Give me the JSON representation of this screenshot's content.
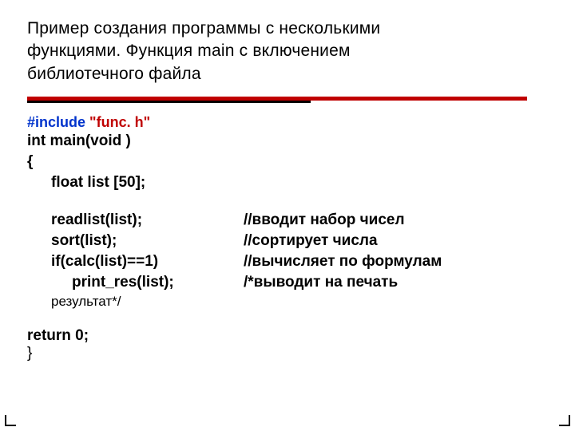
{
  "title": {
    "line1": "Пример создания программы с несколькими",
    "line2": "функциями. Функция main с включением",
    "line3": "библиотечного файла"
  },
  "include": {
    "directive": "#include",
    "file": "\"func. h\""
  },
  "code": {
    "decl": "int main(void )",
    "open": "{",
    "arrdecl": "float list [50];",
    "calls": [
      {
        "stmt": "readlist(list);",
        "comment": "//вводит набор чисел"
      },
      {
        "stmt": "sort(list);",
        "comment": "//сортирует числа"
      },
      {
        "stmt": "if(calс(list)==1)",
        "comment": "//вычисляет по формулам"
      },
      {
        "stmt": "print_res(list);",
        "comment": "/*выводит на печать"
      }
    ],
    "result_tail": "результат*/",
    "ret": "return 0;",
    "close": "}"
  }
}
